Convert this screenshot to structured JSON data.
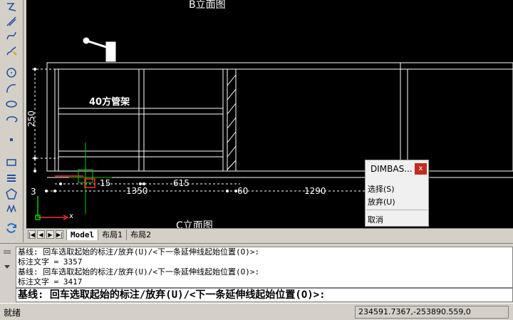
{
  "canvas": {
    "labels": {
      "b_elevation": "B立面图",
      "c_elevation": "C立面图",
      "pipe_rack": "40方管架",
      "dim_250": "250",
      "dim_15": "15",
      "dim_615": "615",
      "dim_1350": "1350",
      "dim_60": "60",
      "dim_1290": "1290",
      "dim_3": "3",
      "axis_x": "x"
    }
  },
  "tabs": {
    "nav": [
      "|◀",
      "◀",
      "▶",
      "▶|"
    ],
    "items": [
      "Model",
      "布局1",
      "布局2"
    ]
  },
  "command": {
    "history": [
      "基线:  回车选取起始的标注/放弃(U)/<下一条延伸线起始位置(O)>:",
      "标注文字 = 3357",
      "基线:  回车选取起始的标注/放弃(U)/<下一条延伸线起始位置(O)>:",
      "标注文字 = 3417"
    ],
    "prompt": "基线:  回车选取起始的标注/放弃(U)/<下一条延伸线起始位置(O)>:"
  },
  "popup": {
    "title": "DIMBAS...",
    "close": "x",
    "select": "选择(S)",
    "undo": "放弃(U)",
    "cancel": "取消"
  },
  "status": {
    "text": "就绪",
    "coords": "234591.7367,-253890.559,0"
  },
  "colors": {
    "canvas_bg": "#000000",
    "cad_lines": "#ffffff",
    "selection_green": "#00cc00",
    "ucs_red": "#ff3030",
    "popup_close": "#c42b1c"
  }
}
